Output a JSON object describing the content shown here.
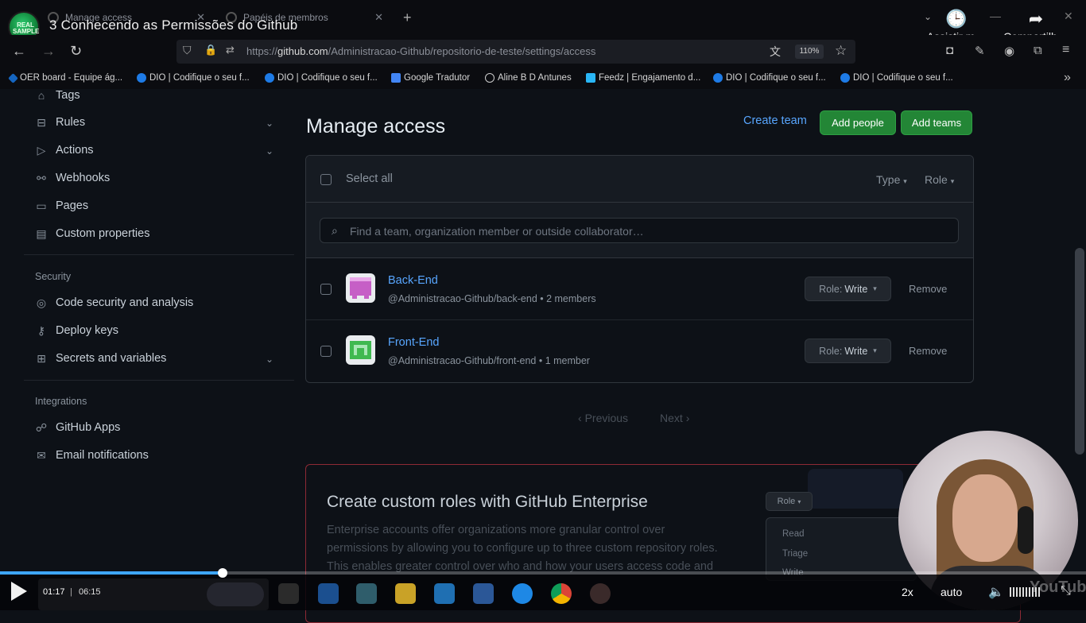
{
  "video": {
    "title": "3 Conhecendo as Permissões do Github",
    "channel_logo_text": "REAL SAMPLE",
    "watch_later": "Assistir m…",
    "share": "Compartilh…",
    "current_time": "01:17",
    "separator": "|",
    "total_time": "06:15",
    "progress": 0.205,
    "speed": "2x",
    "quality": "auto",
    "watermark": "YouTube"
  },
  "browser": {
    "tabs": [
      {
        "label": "Manage access"
      },
      {
        "label": "Papéis de membros"
      }
    ],
    "url_prefix": "https://",
    "url_domain": "github.com",
    "url_path": "/Administracao-Github/repositorio-de-teste/settings/access",
    "zoom": "110%",
    "bookmarks": [
      "OER board - Equipe ág...",
      "DIO | Codifique o seu f...",
      "DIO | Codifique o seu f...",
      "Google Tradutor",
      "Aline B D Antunes",
      "Feedz | Engajamento d...",
      "DIO | Codifique o seu f...",
      "DIO | Codifique o seu f..."
    ]
  },
  "sidebar": {
    "items_top": [
      {
        "label": "Tags",
        "icon": "tag-icon"
      },
      {
        "label": "Rules",
        "icon": "rules-icon"
      },
      {
        "label": "Actions",
        "icon": "play-icon"
      },
      {
        "label": "Webhooks",
        "icon": "webhook-icon"
      },
      {
        "label": "Pages",
        "icon": "browser-icon"
      },
      {
        "label": "Custom properties",
        "icon": "note-icon"
      }
    ],
    "security_heading": "Security",
    "security_items": [
      {
        "label": "Code security and analysis",
        "icon": "codescan-icon"
      },
      {
        "label": "Deploy keys",
        "icon": "key-icon"
      },
      {
        "label": "Secrets and variables",
        "icon": "asterisk-icon"
      }
    ],
    "integrations_heading": "Integrations",
    "integration_items": [
      {
        "label": "GitHub Apps",
        "icon": "apps-icon"
      },
      {
        "label": "Email notifications",
        "icon": "mail-icon"
      }
    ]
  },
  "main": {
    "title": "Manage access",
    "create_team": "Create team",
    "add_people": "Add people",
    "add_teams": "Add teams",
    "select_all": "Select all",
    "type_filter": "Type",
    "role_filter": "Role",
    "search_placeholder": "Find a team, organization member or outside collaborator…",
    "rows": [
      {
        "name": "Back-End",
        "sub": "@Administracao-Github/back-end • 2 members",
        "role_prefix": "Role:",
        "role": "Write",
        "remove": "Remove",
        "avatar_color": "#c65fc6"
      },
      {
        "name": "Front-End",
        "sub": "@Administracao-Github/front-end • 1 member",
        "role_prefix": "Role:",
        "role": "Write",
        "remove": "Remove",
        "avatar_color": "#3fb950"
      }
    ],
    "prev": "Previous",
    "next": "Next"
  },
  "enterprise": {
    "title": "Create custom roles with GitHub Enterprise",
    "lines": [
      "Enterprise accounts offer organizations more granular control over",
      "permissions by allowing you to configure up to three custom repository roles.",
      "This enables greater control over who and how your users access code and"
    ],
    "role_button": "Role",
    "menu": [
      "Read",
      "Triage",
      "Write"
    ]
  },
  "colors": {
    "accent_link": "#58a6ff",
    "primary_button": "#238636",
    "progress": "#3ea6ff"
  }
}
